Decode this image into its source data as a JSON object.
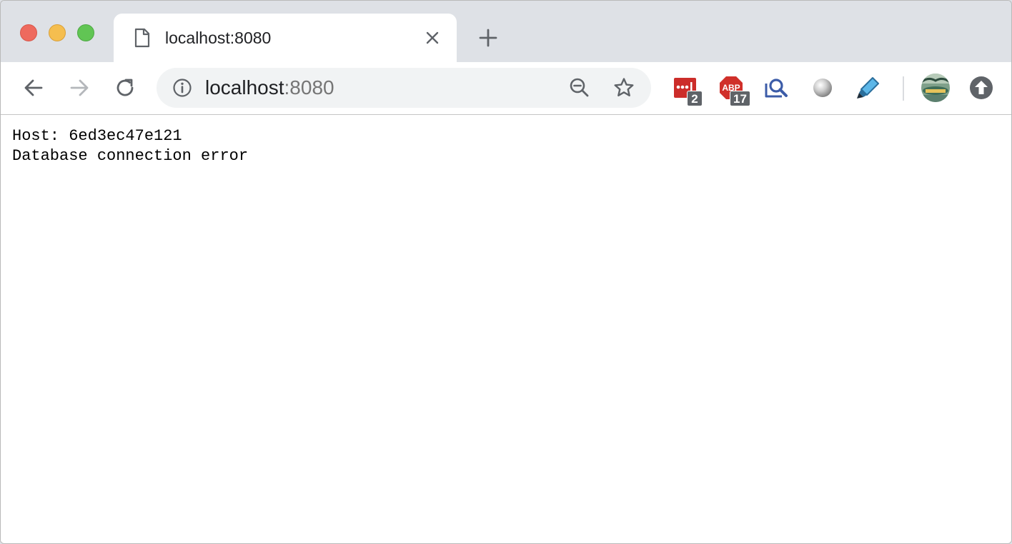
{
  "tab": {
    "title": "localhost:8080"
  },
  "address_bar": {
    "host": "localhost",
    "port": ":8080"
  },
  "extensions": {
    "lastpass_badge": "2",
    "adblock_label": "ABP",
    "adblock_badge": "17"
  },
  "page": {
    "lines": [
      "Host: 6ed3ec47e121",
      "Database connection error"
    ]
  },
  "colors": {
    "traffic_close": "#ee6a5e",
    "traffic_minimize": "#f5be4f",
    "traffic_maximize": "#61c554",
    "lastpass_red": "#cc2d2a",
    "adblock_red": "#d0302a"
  }
}
